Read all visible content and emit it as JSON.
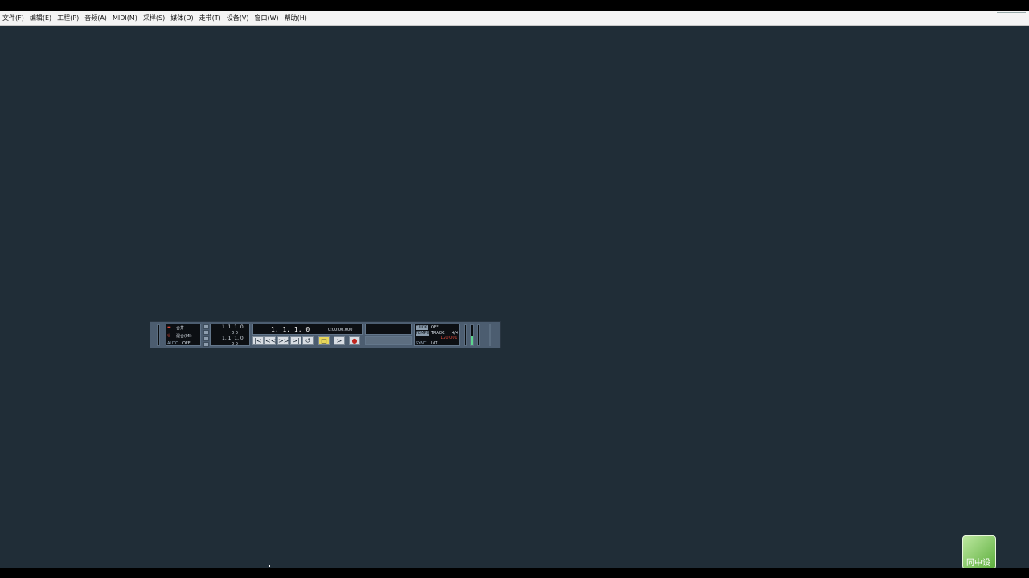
{
  "menu": {
    "items": [
      {
        "label": "文件(F)"
      },
      {
        "label": "编辑(E)"
      },
      {
        "label": "工程(P)"
      },
      {
        "label": "音频(A)"
      },
      {
        "label": "MIDI(M)"
      },
      {
        "label": "采样(S)"
      },
      {
        "label": "媒体(D)"
      },
      {
        "label": "走带(T)"
      },
      {
        "label": "设备(V)"
      },
      {
        "label": "窗口(W)"
      },
      {
        "label": "帮助(H)"
      }
    ]
  },
  "transport": {
    "record_mode": "合并",
    "cycle_mode": "混合(MI)",
    "auto_label": "AUTO",
    "auto_value": "OFF",
    "left_locator": "1. 1. 1.   0",
    "left_locator_sub": "0   0",
    "right_locator": "1. 1. 1.   0",
    "right_locator_sub": "0   0",
    "position_bars": "1. 1. 1.   0",
    "position_time": "0:00:00.000",
    "buttons": {
      "to_start": "|<",
      "rewind": "<<",
      "forward": ">>",
      "to_end": ">|",
      "cycle": "↺",
      "stop": "□",
      "play": ">",
      "record": "●"
    },
    "click_label": "CLICK",
    "click_value": "OFF",
    "tempo_label": "TEMPO",
    "tempo_mode": "TRACK",
    "signature": "4/4",
    "tempo_value": "120.000",
    "sync_label": "SYNC",
    "sync_value": "INT.",
    "meter_level_fraction": 0.45
  },
  "watermark": {
    "text": "同中设"
  },
  "colors": {
    "background": "#202d37",
    "menubar": "#f4f4f4",
    "transport": "#4c5d70",
    "stop_active": "#e7d65a",
    "meter_green": "#5bd68c",
    "tempo_red": "#e04a3a"
  }
}
